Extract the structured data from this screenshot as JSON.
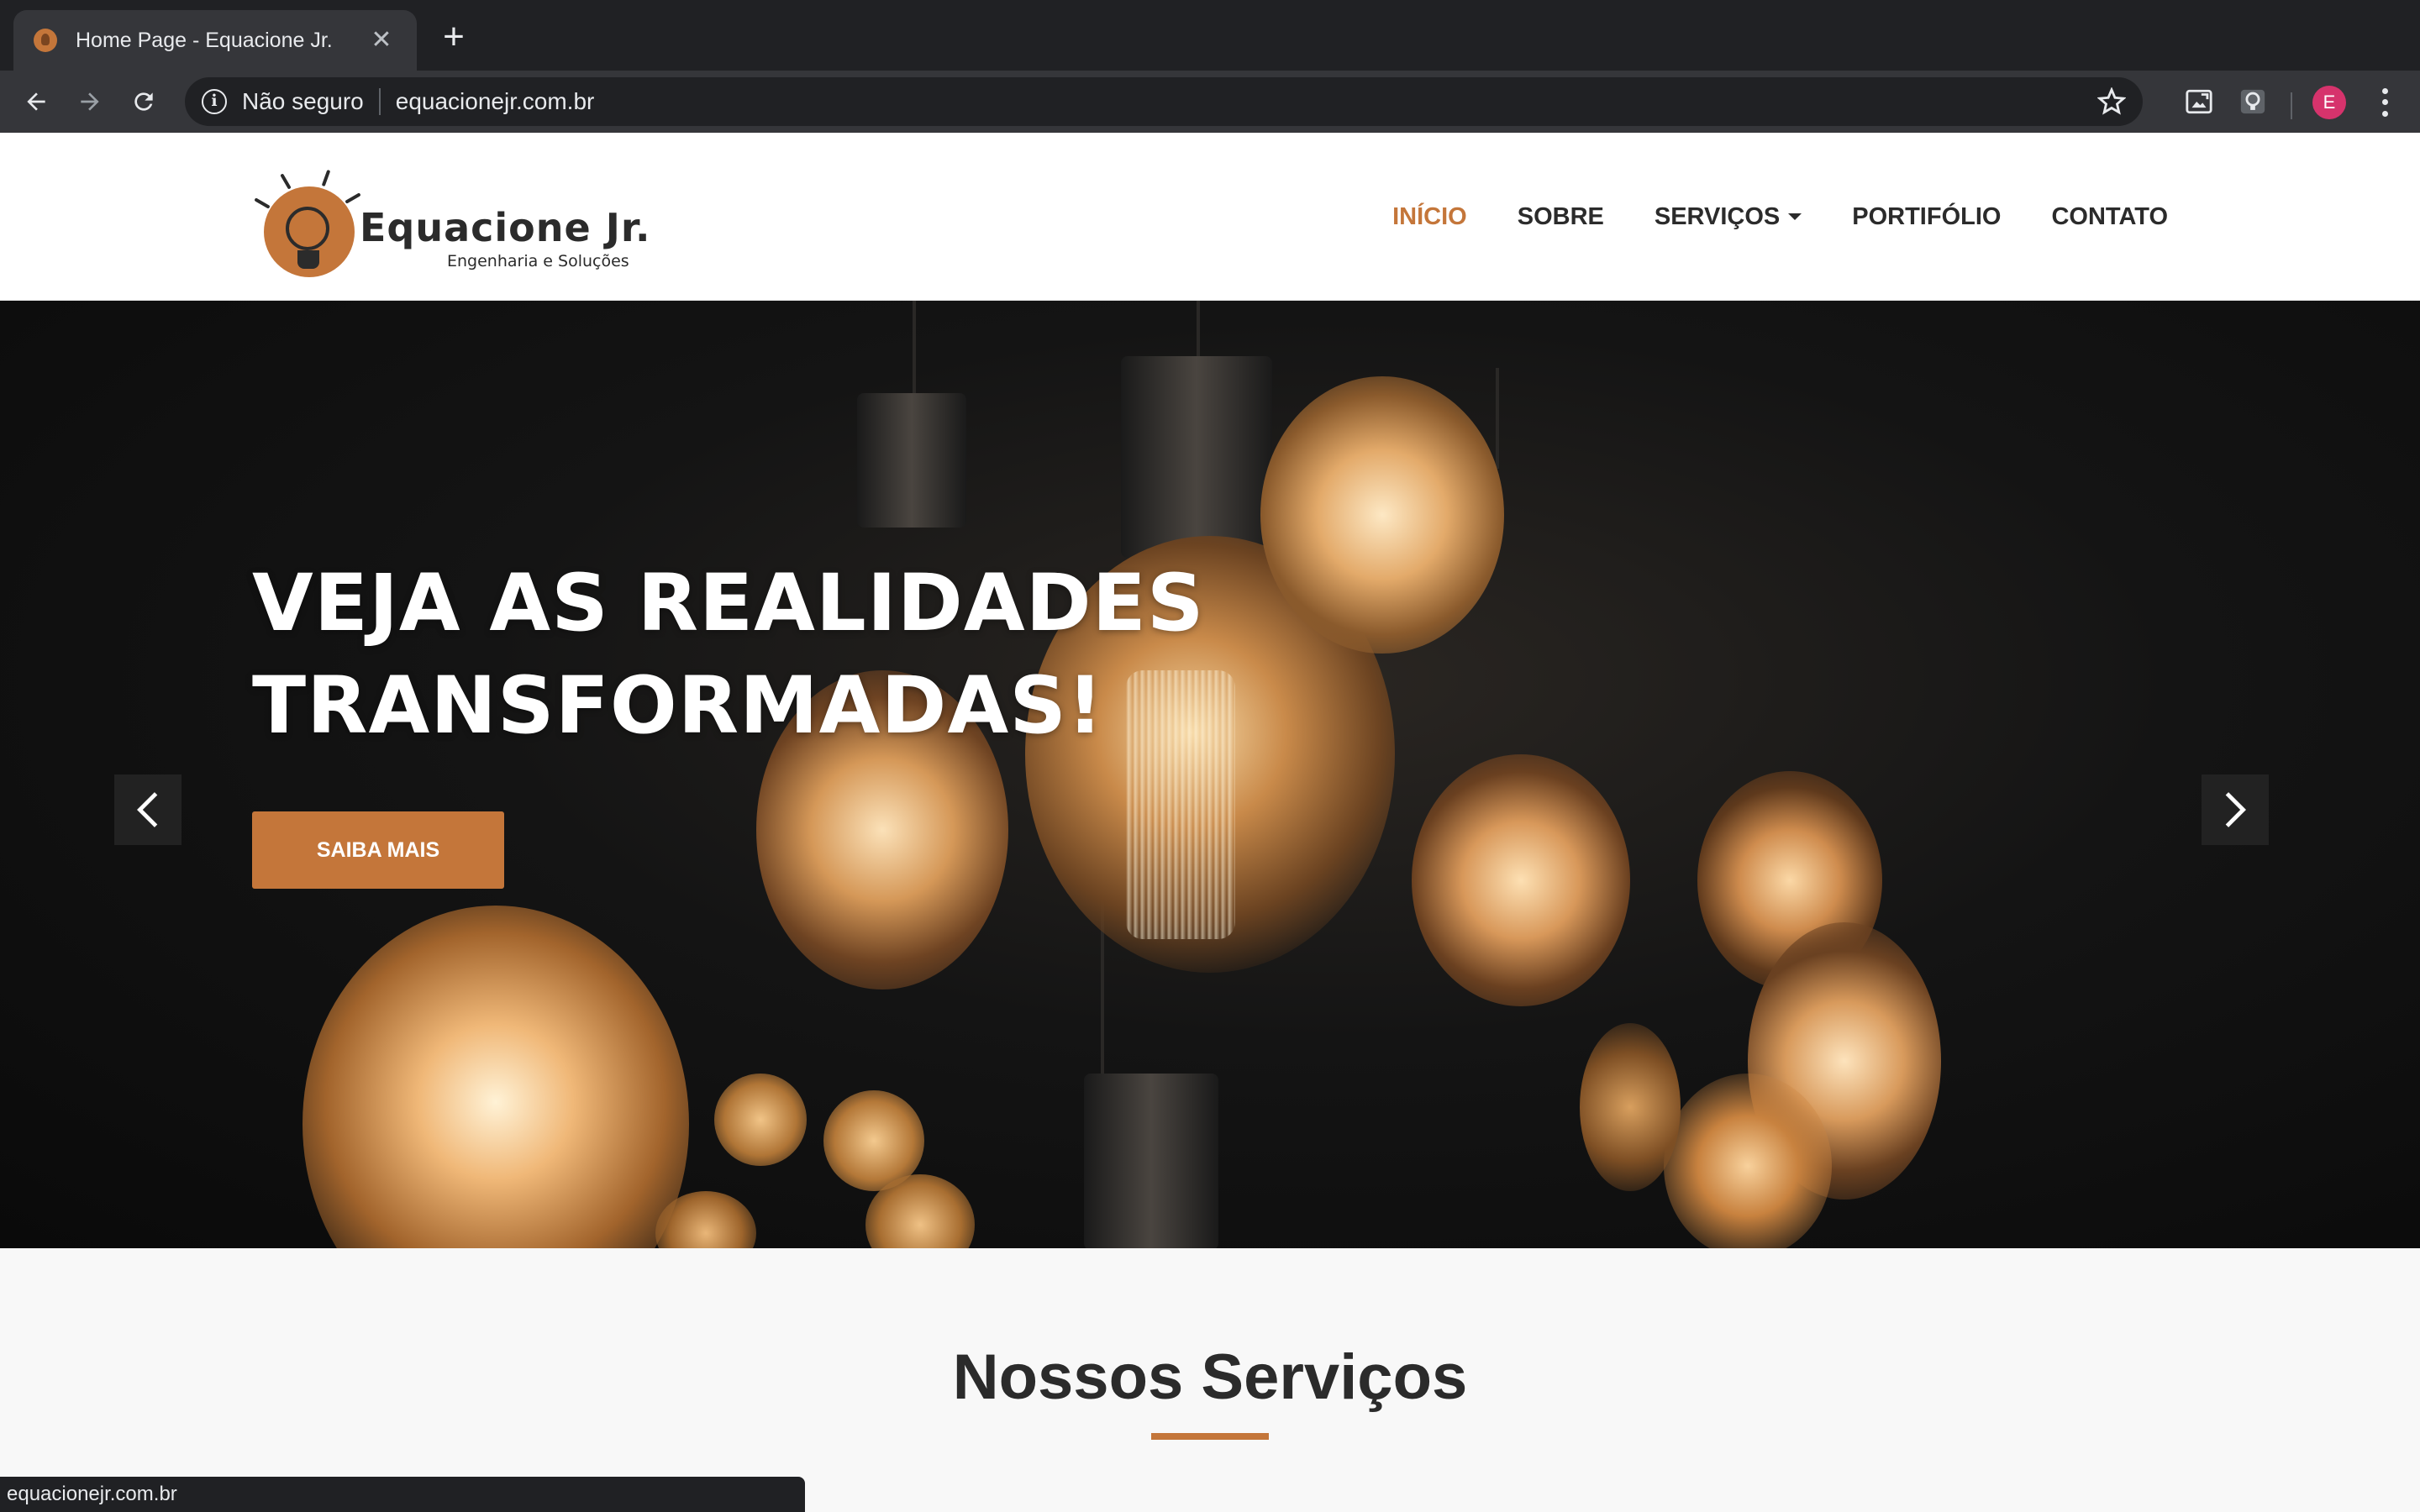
{
  "browser": {
    "tab_title": "Home Page - Equacione Jr.",
    "tab_close": "✕",
    "new_tab": "+",
    "security_label": "Não seguro",
    "url": "equacionejr.com.br",
    "info_icon": "i",
    "profile_initial": "E"
  },
  "site": {
    "logo_name": "Equacione Jr.",
    "logo_tagline": "Engenharia e Soluções",
    "nav": [
      {
        "label": "INÍCIO",
        "active": true
      },
      {
        "label": "SOBRE",
        "active": false
      },
      {
        "label": "SERVIÇOS",
        "active": false
      },
      {
        "label": "PORTIFÓLIO",
        "active": false
      },
      {
        "label": "CONTATO",
        "active": false
      }
    ]
  },
  "hero": {
    "title_line1": "VEJA AS REALIDADES",
    "title_line2": "TRANSFORMADAS!",
    "cta_label": "SAIBA MAIS"
  },
  "services": {
    "title": "Nossos Serviços"
  },
  "status_bar": {
    "text": "equacionejr.com.br"
  },
  "colors": {
    "accent": "#c4763a",
    "text_dark": "#2b2b2b",
    "chrome_dark": "#202124",
    "chrome_mid": "#35363a",
    "profile": "#d6336c"
  }
}
